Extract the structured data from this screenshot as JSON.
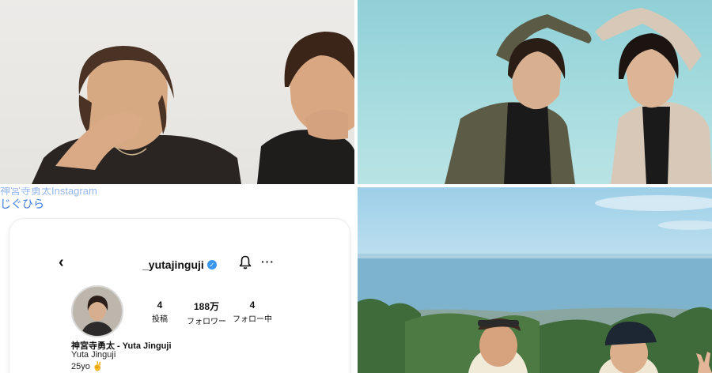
{
  "collage": {
    "top_left": {
      "alt": "two men posing against a light wall"
    },
    "top_right": {
      "alt": "two men forming a heart with their arms"
    },
    "bottom_right": {
      "alt": "two men in front of a sea and forest view"
    }
  },
  "instagram": {
    "cut_text": "神宮寺勇太Instagram",
    "link_text": "じぐひら",
    "back_glyph": "‹",
    "username": "_yutajinguji",
    "verified_glyph": "✓",
    "more_glyph": "···",
    "stats": [
      {
        "value": "4",
        "label": "投稿"
      },
      {
        "value": "188万",
        "label": "フォロワー"
      },
      {
        "value": "4",
        "label": "フォロー中"
      }
    ],
    "display_name": "神宮寺勇太 - Yuta Jinguji",
    "subtitle": "Yuta Jinguji",
    "bio": "25yo ✌️"
  },
  "icons": {
    "back": "chevron-left-icon",
    "verified": "verified-badge-icon",
    "notifications": "bell-icon",
    "more": "more-options-icon"
  }
}
